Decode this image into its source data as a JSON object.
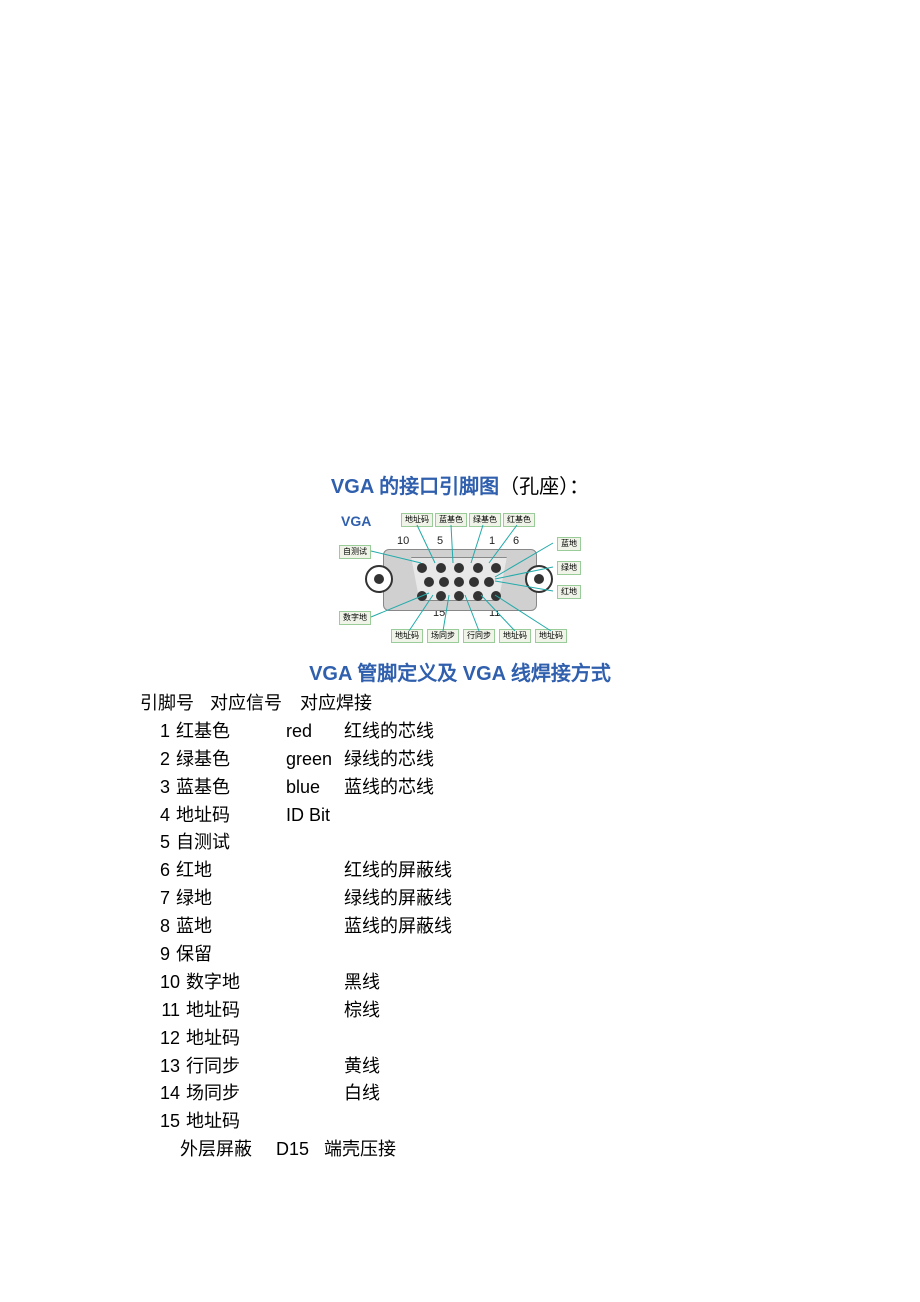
{
  "title1_blue": "VGA 的接口引脚图",
  "title1_black": "（孔座）：",
  "title2": "VGA 管脚定义及 VGA 线焊接方式",
  "diagram": {
    "label": "VGA",
    "nums": {
      "n10": "10",
      "n5": "5",
      "n1": "1",
      "n6": "6",
      "n15": "15",
      "n11": "11"
    },
    "tags": {
      "top1": "地址码",
      "top2": "蓝基色",
      "top3": "绿基色",
      "top4": "红基色",
      "r1": "蓝地",
      "r2": "绿地",
      "r3": "红地",
      "left1": "自测试",
      "left2": "数字地",
      "bot1": "地址码",
      "bot2": "场同步",
      "bot3": "行同步",
      "bot4": "地址码",
      "bot5": "地址码"
    }
  },
  "headers": {
    "h1": "引脚号",
    "h2": "对应信号",
    "h3": "对应焊接"
  },
  "rows": [
    {
      "n": "1",
      "sig": "红基色",
      "en": "red",
      "wire": "红线的芯线"
    },
    {
      "n": "2",
      "sig": "绿基色",
      "en": "green",
      "wire": "绿线的芯线"
    },
    {
      "n": "3",
      "sig": "蓝基色",
      "en": "blue",
      "wire": "蓝线的芯线"
    },
    {
      "n": "4",
      "sig": "地址码",
      "en": "ID Bit",
      "wire": ""
    },
    {
      "n": "5",
      "sig": "自测试",
      "en": "",
      "wire": ""
    },
    {
      "n": "6",
      "sig": "红地",
      "en": "",
      "wire": "红线的屏蔽线"
    },
    {
      "n": "7",
      "sig": "绿地",
      "en": "",
      "wire": "绿线的屏蔽线"
    },
    {
      "n": "8",
      "sig": "蓝地",
      "en": "",
      "wire": "蓝线的屏蔽线"
    },
    {
      "n": "9",
      "sig": "保留",
      "en": "",
      "wire": ""
    },
    {
      "n": "10",
      "sig": "数字地",
      "en": "",
      "wire": "黑线"
    },
    {
      "n": "11",
      "sig": "地址码",
      "en": "",
      "wire": "棕线"
    },
    {
      "n": "12",
      "sig": "地址码",
      "en": "",
      "wire": ""
    },
    {
      "n": "13",
      "sig": "行同步",
      "en": "",
      "wire": "黄线"
    },
    {
      "n": "14",
      "sig": "场同步",
      "en": "",
      "wire": "白线"
    },
    {
      "n": "15",
      "sig": "地址码",
      "en": "",
      "wire": ""
    }
  ],
  "footer": {
    "label": "外层屏蔽",
    "en": "D15",
    "wire": "端壳压接"
  }
}
